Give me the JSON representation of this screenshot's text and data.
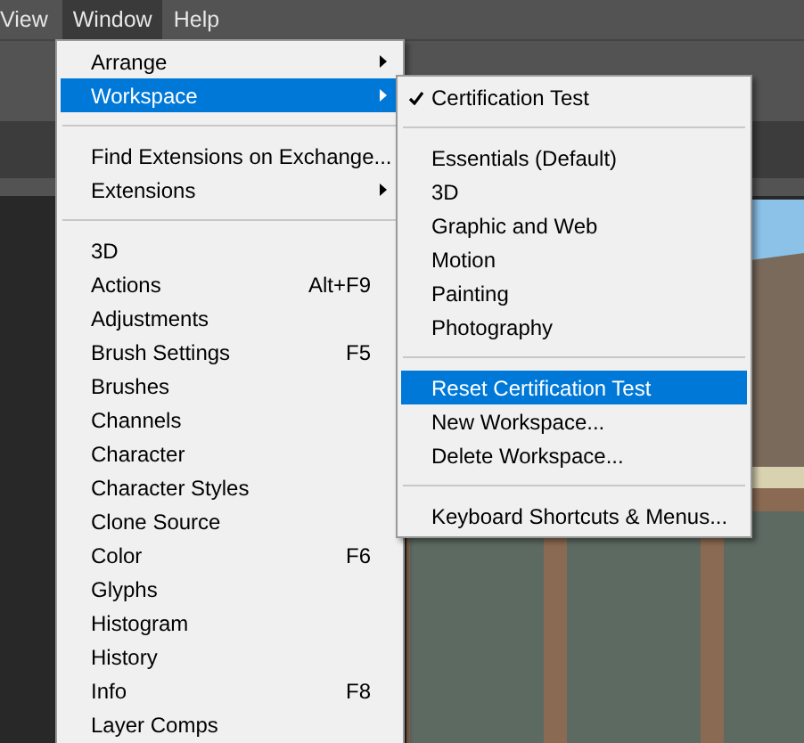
{
  "menubar": [
    {
      "label": "View",
      "selected": false
    },
    {
      "label": "Window",
      "selected": true
    },
    {
      "label": "Help",
      "selected": false
    }
  ],
  "window_menu": [
    {
      "kind": "item",
      "label": "Arrange",
      "submenu": true,
      "highlighted": false
    },
    {
      "kind": "item",
      "label": "Workspace",
      "submenu": true,
      "highlighted": true
    },
    {
      "kind": "separator"
    },
    {
      "kind": "item",
      "label": "Find Extensions on Exchange...",
      "submenu": false,
      "highlighted": false
    },
    {
      "kind": "item",
      "label": "Extensions",
      "submenu": true,
      "highlighted": false
    },
    {
      "kind": "separator"
    },
    {
      "kind": "item",
      "label": "3D",
      "submenu": false,
      "highlighted": false
    },
    {
      "kind": "item",
      "label": "Actions",
      "shortcut": "Alt+F9",
      "submenu": false,
      "highlighted": false
    },
    {
      "kind": "item",
      "label": "Adjustments",
      "submenu": false,
      "highlighted": false
    },
    {
      "kind": "item",
      "label": "Brush Settings",
      "shortcut": "F5",
      "submenu": false,
      "highlighted": false
    },
    {
      "kind": "item",
      "label": "Brushes",
      "submenu": false,
      "highlighted": false
    },
    {
      "kind": "item",
      "label": "Channels",
      "submenu": false,
      "highlighted": false
    },
    {
      "kind": "item",
      "label": "Character",
      "submenu": false,
      "highlighted": false
    },
    {
      "kind": "item",
      "label": "Character Styles",
      "submenu": false,
      "highlighted": false
    },
    {
      "kind": "item",
      "label": "Clone Source",
      "submenu": false,
      "highlighted": false
    },
    {
      "kind": "item",
      "label": "Color",
      "shortcut": "F6",
      "submenu": false,
      "highlighted": false
    },
    {
      "kind": "item",
      "label": "Glyphs",
      "submenu": false,
      "highlighted": false
    },
    {
      "kind": "item",
      "label": "Histogram",
      "submenu": false,
      "highlighted": false
    },
    {
      "kind": "item",
      "label": "History",
      "submenu": false,
      "highlighted": false
    },
    {
      "kind": "item",
      "label": "Info",
      "shortcut": "F8",
      "submenu": false,
      "highlighted": false
    },
    {
      "kind": "item",
      "label": "Layer Comps",
      "submenu": false,
      "highlighted": false
    }
  ],
  "workspace_submenu": [
    {
      "kind": "item",
      "label": "Certification Test",
      "checked": true,
      "highlighted": false
    },
    {
      "kind": "separator"
    },
    {
      "kind": "item",
      "label": "Essentials (Default)",
      "checked": false,
      "highlighted": false
    },
    {
      "kind": "item",
      "label": "3D",
      "checked": false,
      "highlighted": false
    },
    {
      "kind": "item",
      "label": "Graphic and Web",
      "checked": false,
      "highlighted": false
    },
    {
      "kind": "item",
      "label": "Motion",
      "checked": false,
      "highlighted": false
    },
    {
      "kind": "item",
      "label": "Painting",
      "checked": false,
      "highlighted": false
    },
    {
      "kind": "item",
      "label": "Photography",
      "checked": false,
      "highlighted": false
    },
    {
      "kind": "separator"
    },
    {
      "kind": "item",
      "label": "Reset Certification Test",
      "checked": false,
      "highlighted": true
    },
    {
      "kind": "item",
      "label": "New Workspace...",
      "checked": false,
      "highlighted": false
    },
    {
      "kind": "item",
      "label": "Delete Workspace...",
      "checked": false,
      "highlighted": false
    },
    {
      "kind": "separator"
    },
    {
      "kind": "item",
      "label": "Keyboard Shortcuts & Menus...",
      "checked": false,
      "highlighted": false
    }
  ]
}
